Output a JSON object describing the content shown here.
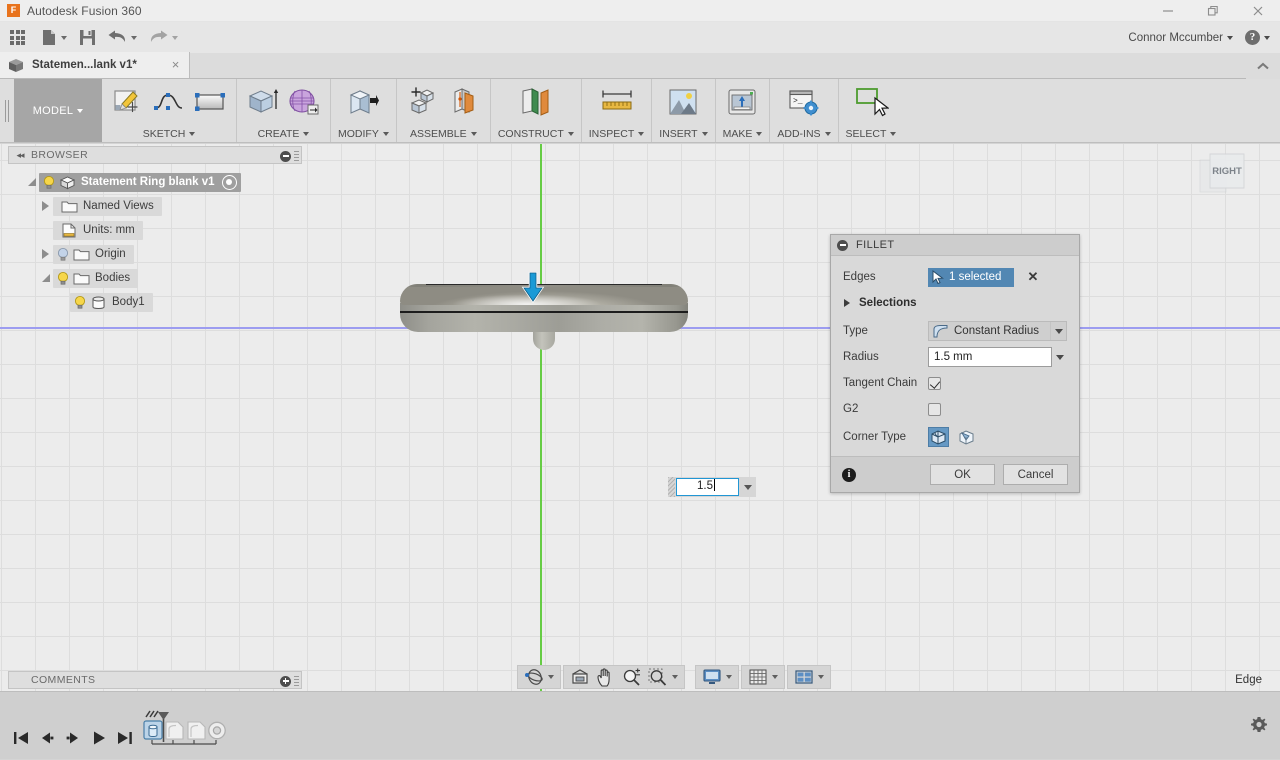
{
  "titlebar": {
    "app_name": "Autodesk Fusion 360",
    "logo_letter": "F",
    "minimize": "minimize-icon",
    "restore": "restore-icon",
    "close": "close-icon"
  },
  "quick_access": {
    "grid_menu": "app-grid-icon",
    "new_file": "new-file-icon",
    "save": "save-icon",
    "undo": "undo-icon",
    "redo": "redo-icon",
    "user_name": "Connor Mccumber",
    "help_label": "?"
  },
  "tabbar": {
    "tabs": [
      {
        "label": "Statemen...lank v1*",
        "close": "×",
        "active": true
      }
    ],
    "collapse": "chevron-up-icon"
  },
  "ribbon": {
    "workspace": "MODEL",
    "panels": [
      {
        "label": "SKETCH",
        "icons": [
          "create-sketch-icon",
          "spline-icon",
          "rectangle-icon"
        ]
      },
      {
        "label": "CREATE",
        "icons": [
          "extrude-icon",
          "create-form-icon"
        ]
      },
      {
        "label": "MODIFY",
        "icons": [
          "press-pull-icon"
        ]
      },
      {
        "label": "ASSEMBLE",
        "icons": [
          "new-component-icon",
          "joint-icon"
        ]
      },
      {
        "label": "CONSTRUCT",
        "icons": [
          "offset-plane-icon"
        ]
      },
      {
        "label": "INSPECT",
        "icons": [
          "measure-icon"
        ]
      },
      {
        "label": "INSERT",
        "icons": [
          "insert-image-icon"
        ]
      },
      {
        "label": "MAKE",
        "icons": [
          "3d-print-icon"
        ]
      },
      {
        "label": "ADD-INS",
        "icons": [
          "scripts-addins-icon"
        ]
      },
      {
        "label": "SELECT",
        "icons": [
          "select-window-icon"
        ]
      }
    ]
  },
  "browser": {
    "title": "BROWSER",
    "collapse_icon": "collapse-left-icon",
    "minus_icon": "minus-circle-icon",
    "grip_icon": "grip-handle-icon",
    "tree": [
      {
        "label": "Statement Ring blank v1",
        "indent": 0,
        "twist": "open",
        "root": true,
        "bulb": "on",
        "icon": "component-cube-icon",
        "eye": true
      },
      {
        "label": "Named Views",
        "indent": 1,
        "twist": "right",
        "root": false,
        "bulb": "none",
        "icon": "folder-icon",
        "eye": false
      },
      {
        "label": "Units: mm",
        "indent": 1,
        "twist": "none",
        "root": false,
        "bulb": "none",
        "icon": "document-units-icon",
        "eye": false
      },
      {
        "label": "Origin",
        "indent": 1,
        "twist": "right",
        "root": false,
        "bulb": "off",
        "icon": "folder-icon",
        "eye": false
      },
      {
        "label": "Bodies",
        "indent": 1,
        "twist": "open",
        "root": false,
        "bulb": "on",
        "icon": "folder-icon",
        "eye": false
      },
      {
        "label": "Body1",
        "indent": 2,
        "twist": "none",
        "root": false,
        "bulb": "on",
        "icon": "body-icon",
        "eye": false
      }
    ]
  },
  "canvas": {
    "view_cube_label": "RIGHT",
    "manipulator": "blue-down-arrow-icon",
    "value_field": {
      "value": "1.5",
      "dropdown": "chevron-down-icon"
    }
  },
  "fillet_dialog": {
    "title": "FILLET",
    "collapse_icon": "minus-circle-icon",
    "edges_label": "Edges",
    "edges_chip": "1 selected",
    "edges_clear": "✕",
    "selections_label": "Selections",
    "type_label": "Type",
    "type_value": "Constant Radius",
    "radius_label": "Radius",
    "radius_value": "1.5 mm",
    "tangent_chain_label": "Tangent Chain",
    "tangent_chain_checked": true,
    "g2_label": "G2",
    "g2_checked": false,
    "corner_type_label": "Corner Type",
    "corner_type_options": [
      "rolling-ball-icon",
      "setback-icon"
    ],
    "corner_type_selected": 0,
    "info_icon": "info-icon",
    "ok_label": "OK",
    "cancel_label": "Cancel",
    "accent_color": "#5287b3"
  },
  "comments": {
    "title": "COMMENTS",
    "add_icon": "plus-circle-icon",
    "grip_icon": "grip-handle-icon"
  },
  "navbar": {
    "groups": [
      {
        "buttons": [
          "orbit-icon"
        ],
        "has_caret": true
      },
      {
        "buttons": [
          "look-at-icon"
        ],
        "has_caret": false
      },
      {
        "buttons": [
          "pan-icon"
        ],
        "has_caret": false
      },
      {
        "buttons": [
          "zoom-icon"
        ],
        "has_caret": false
      },
      {
        "buttons": [
          "zoom-window-icon"
        ],
        "has_caret": true
      }
    ],
    "display_groups": [
      {
        "buttons": [
          "display-settings-icon"
        ],
        "has_caret": true
      },
      {
        "buttons": [
          "grid-snaps-icon"
        ],
        "has_caret": true
      },
      {
        "buttons": [
          "viewports-icon"
        ],
        "has_caret": true
      }
    ]
  },
  "status": {
    "selection_filter": "Edge"
  },
  "timeline": {
    "playback": [
      "go-to-start-icon",
      "step-back-icon",
      "step-forward-icon",
      "play-icon",
      "go-to-end-icon"
    ],
    "features": [
      "extrude-feature-icon",
      "fillet-feature-pending-icon",
      "fillet-feature-pending-icon",
      "hole-feature-icon"
    ],
    "settings_icon": "gear-icon"
  }
}
